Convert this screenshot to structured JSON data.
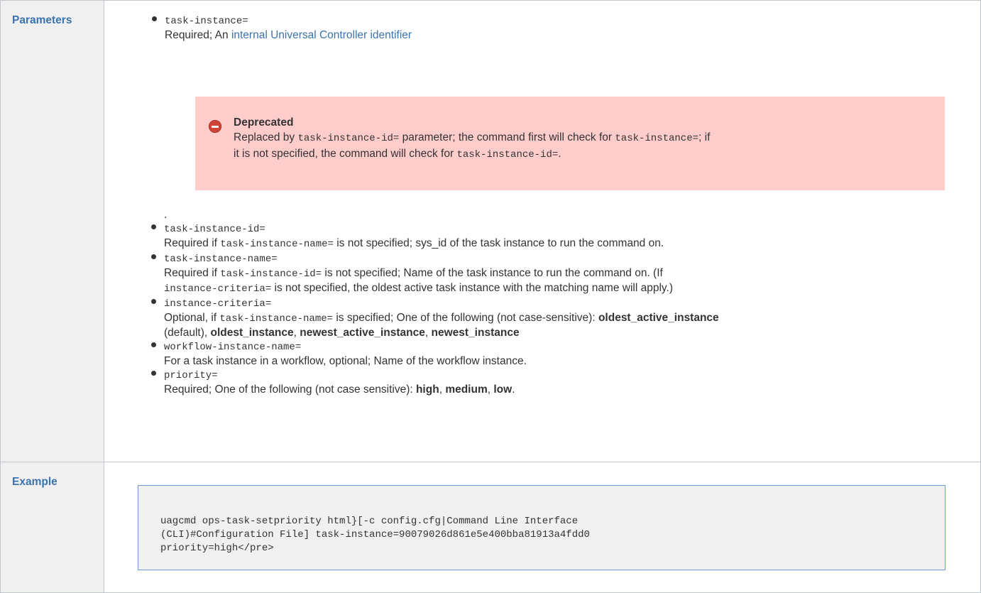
{
  "headers": {
    "parameters": "Parameters",
    "example": "Example"
  },
  "task_instance": {
    "name": "task-instance=",
    "desc_prefix": "Required; An ",
    "link_text": "internal Universal Controller identifier"
  },
  "deprecated": {
    "title": "Deprecated",
    "t1": "Replaced by ",
    "c1": "task-instance-id=",
    "t2": " parameter; the command first will check for ",
    "c2": "task-instance=",
    "t3": "; if",
    "t4": "it is not specified, the command will check for ",
    "c3": "task-instance-id=",
    "t5": "."
  },
  "period": ".",
  "task_instance_id": {
    "name": "task-instance-id=",
    "t1": "Required if ",
    "c1": "task-instance-name=",
    "t2": " is not specified; sys_id of the task instance to run the command on."
  },
  "task_instance_name": {
    "name": "task-instance-name=",
    "t1": "Required if ",
    "c1": "task-instance-id=",
    "t2": " is not specified; Name of the task instance to run the command on. (If",
    "c2": "instance-criteria=",
    "t3": " is not specified, the oldest active task instance with the matching name will apply.)"
  },
  "instance_criteria": {
    "name": "instance-criteria=",
    "t1": "Optional, if ",
    "c1": "task-instance-name=",
    "t2": " is specified; One of the following (not case-sensitive): ",
    "b1": "oldest_active_instance",
    "t3": "(default), ",
    "b2": "oldest_instance",
    "s1": ", ",
    "b3": "newest_active_instance",
    "s2": ", ",
    "b4": "newest_instance"
  },
  "workflow_instance_name": {
    "name": "workflow-instance-name=",
    "desc": "For a task instance in a workflow, optional; Name of the workflow instance."
  },
  "priority": {
    "name": "priority=",
    "t1": "Required; One of the following (not case sensitive): ",
    "b1": "high",
    "s1": ", ",
    "b2": "medium",
    "s2": ", ",
    "b3": "low",
    "s3": "."
  },
  "example": {
    "line1": "uagcmd ops-task-setpriority html}[-c config.cfg|Command Line Interface",
    "line2": "(CLI)#Configuration File] task-instance=90079026d861e5e400bba81913a4fdd0",
    "line3": "priority=high</pre>"
  },
  "colors": {
    "header_text": "#3b73af",
    "header_bg": "#f0f0f0",
    "link": "#3b73af",
    "deprecated_bg": "#ffcccc",
    "stop_icon": "#d04437",
    "code_border": "#6b9bd8"
  }
}
